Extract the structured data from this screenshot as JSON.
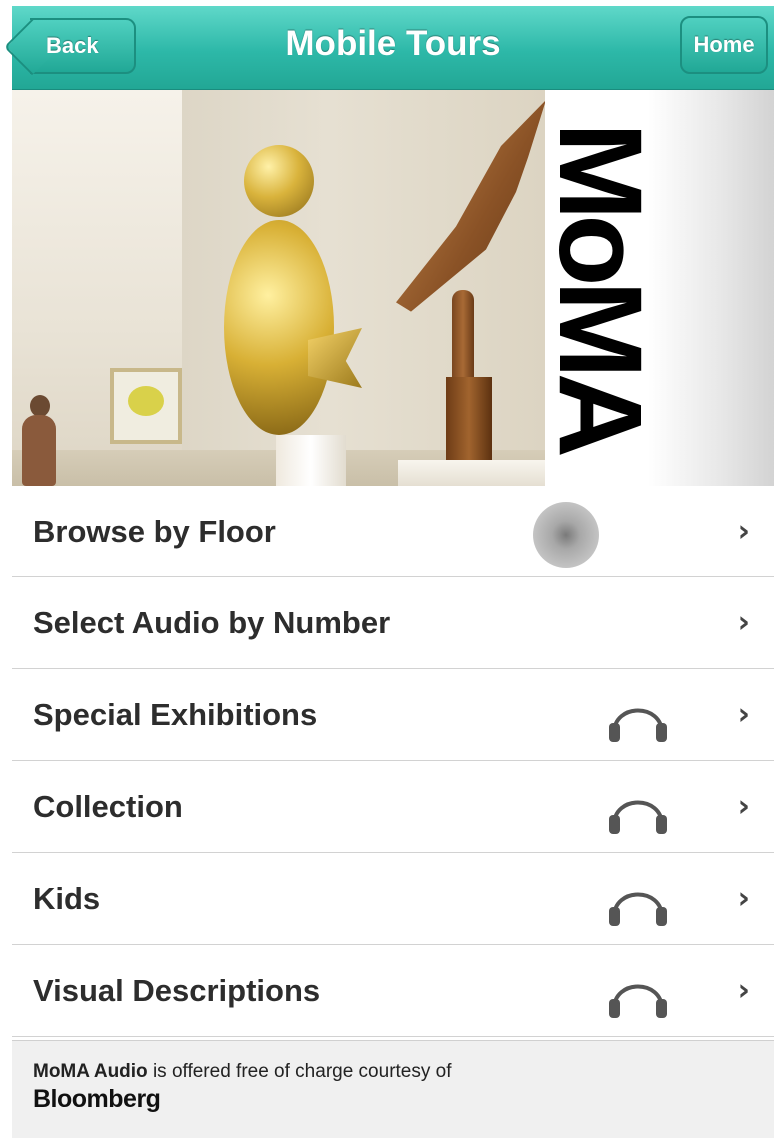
{
  "header": {
    "title": "Mobile Tours",
    "back_label": "Back",
    "home_label": "Home",
    "color": "#2db8a8"
  },
  "hero": {
    "logo_text": "MoMA"
  },
  "menu": {
    "items": [
      {
        "label": "Browse by Floor",
        "icon": "",
        "chevron": "›"
      },
      {
        "label": "Select Audio by Number",
        "icon": "",
        "chevron": "›"
      },
      {
        "label": "Special Exhibitions",
        "icon": "headphones-icon",
        "chevron": "›"
      },
      {
        "label": "Collection",
        "icon": "headphones-icon",
        "chevron": "›"
      },
      {
        "label": "Kids",
        "icon": "headphones-icon",
        "chevron": "›"
      },
      {
        "label": "Visual Descriptions",
        "icon": "headphones-icon",
        "chevron": "›"
      }
    ]
  },
  "footer": {
    "strong": "MoMA Audio",
    "text": " is offered free of charge courtesy of",
    "sponsor": "Bloomberg"
  }
}
